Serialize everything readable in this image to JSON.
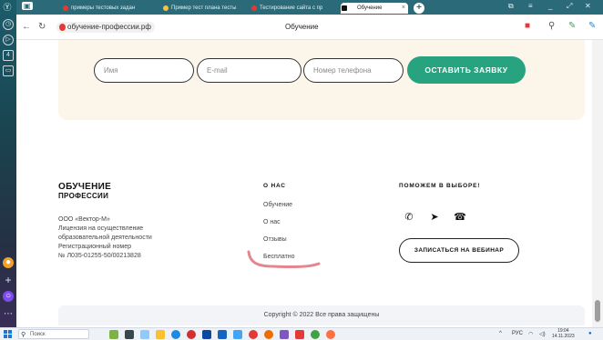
{
  "browser": {
    "tabs": [
      {
        "label": "примеры тестовых задан"
      },
      {
        "label": "Пример тест плана тесты"
      },
      {
        "label": "Тестирование сайта с пр"
      },
      {
        "label": "Обучение"
      }
    ],
    "url": "обучение-профессии.рф",
    "page_title": "Обучение"
  },
  "form": {
    "name_placeholder": "Имя",
    "email_placeholder": "E-mail",
    "phone_placeholder": "Номер телефона",
    "submit_label": "ОСТАВИТЬ ЗАЯВКУ"
  },
  "footer": {
    "brand_line1": "ОБУЧЕНИЕ",
    "brand_line2": "ПРОФЕССИИ",
    "company_lines": [
      "ООО «Вектор-М»",
      "Лицензия на осуществление",
      "образовательной деятельности",
      "Регистрационный номер",
      "№ Л035-01255-50/00213828"
    ],
    "about_title": "О НАС",
    "about_links": [
      "Обучение",
      "О нас",
      "Отзывы",
      "Бесплатно"
    ],
    "help_title": "ПОМОЖЕМ В ВЫБОРЕ!",
    "social_icons": [
      "whatsapp-icon",
      "telegram-icon",
      "phone-icon"
    ],
    "webinar_label": "ЗАПИСАТЬСЯ НА ВЕБИНАР",
    "copyright": "Copyright © 2022 Все права защищены"
  },
  "taskbar": {
    "search_placeholder": "Поиск",
    "lang": "РУС",
    "time": "19:04",
    "date": "14.11.2023"
  },
  "colors": {
    "accent_green": "#27a37f",
    "form_background": "#fbf5ea",
    "annotation_scribble": "#e4868d",
    "tab_bar": "#2b6a78"
  }
}
